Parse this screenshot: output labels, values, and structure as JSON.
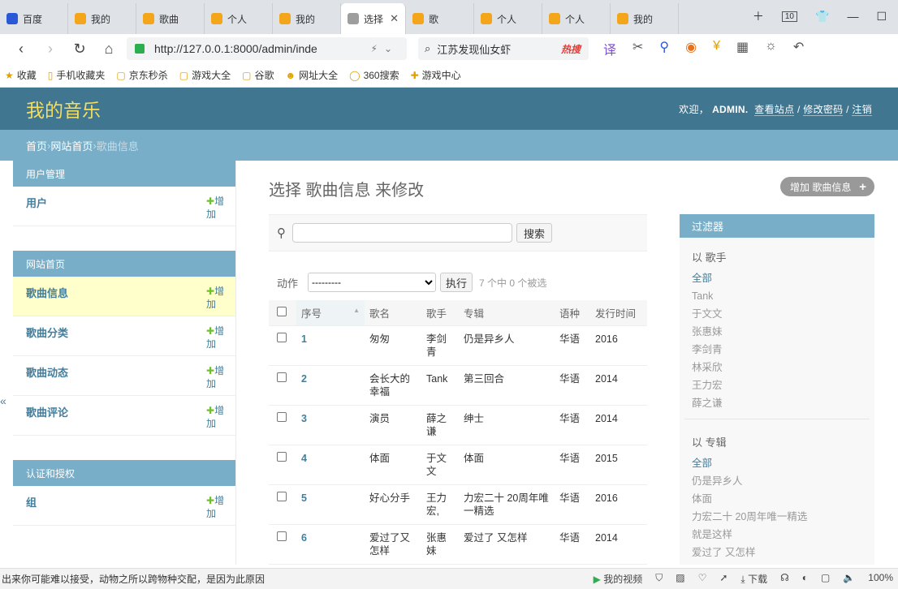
{
  "browser": {
    "tabs": [
      {
        "label": "百度",
        "color": "#2b58d6"
      },
      {
        "label": "我的",
        "color": "#f4a61a"
      },
      {
        "label": "歌曲",
        "color": "#f4a61a"
      },
      {
        "label": "个人",
        "color": "#f4a61a"
      },
      {
        "label": "我的",
        "color": "#f4a61a"
      },
      {
        "label": "选择",
        "color": "#9e9e9e"
      },
      {
        "label": "歌",
        "color": "#f4a61a"
      },
      {
        "label": "个人",
        "color": "#f4a61a"
      },
      {
        "label": "个人",
        "color": "#f4a61a"
      },
      {
        "label": "我的",
        "color": "#f4a61a"
      }
    ],
    "tab_count": "10",
    "url": "http://127.0.0.1:8000/admin/inde",
    "search_text": "江苏发现仙女虾",
    "search_hot": "热搜",
    "bookmarks": [
      "收藏",
      "手机收藏夹",
      "京东秒杀",
      "游戏大全",
      "谷歌",
      "网址大全",
      "360搜索",
      "游戏中心"
    ]
  },
  "header": {
    "brand": "我的音乐",
    "welcome": "欢迎，",
    "user": "ADMIN.",
    "view_site": "查看站点",
    "change_password": "修改密码",
    "logout": "注销",
    "sep": " / "
  },
  "breadcrumbs": {
    "home": "首页",
    "app": "网站首页",
    "current": "歌曲信息",
    "sep": " › "
  },
  "sidebar": {
    "add_label": "增加",
    "modules": [
      {
        "caption": "用户管理",
        "items": [
          {
            "name": "用户"
          }
        ]
      },
      {
        "caption": "网站首页",
        "items": [
          {
            "name": "歌曲信息"
          },
          {
            "name": "歌曲分类"
          },
          {
            "name": "歌曲动态"
          },
          {
            "name": "歌曲评论"
          }
        ]
      },
      {
        "caption": "认证和授权",
        "items": [
          {
            "name": "组"
          }
        ]
      }
    ],
    "collapse": "«"
  },
  "content": {
    "title": "选择 歌曲信息 来修改",
    "add_button": "增加 歌曲信息",
    "search_button": "搜索",
    "action_label": "动作",
    "action_default": "---------",
    "run_button": "执行",
    "selection_count": "7 个中 0 个被选",
    "columns": [
      "序号",
      "歌名",
      "歌手",
      "专辑",
      "语种",
      "发行时间"
    ],
    "rows": [
      [
        "1",
        "匆匆",
        "李剑青",
        "仍是异乡人",
        "华语",
        "2016"
      ],
      [
        "2",
        "会长大的幸福",
        "Tank",
        "第三回合",
        "华语",
        "2014"
      ],
      [
        "3",
        "演员",
        "薛之谦",
        "绅士",
        "华语",
        "2014"
      ],
      [
        "4",
        "体面",
        "于文文",
        "体面",
        "华语",
        "2015"
      ],
      [
        "5",
        "好心分手",
        "王力宏,",
        "力宏二十 20周年唯一精选",
        "华语",
        "2016"
      ],
      [
        "6",
        "爱过了又怎样",
        "张惠妹",
        "爱过了 又怎样",
        "华语",
        "2014"
      ]
    ]
  },
  "filter": {
    "caption": "过滤器",
    "singer_title": "以 歌手",
    "singers": [
      "全部",
      "Tank",
      "于文文",
      "张惠妹",
      "李剑青",
      "林采欣",
      "王力宏",
      "薛之谦"
    ],
    "album_title": "以 专辑",
    "albums": [
      "全部",
      "仍是异乡人",
      "体面",
      "力宏二十 20周年唯一精选",
      "就是这样",
      "爱过了 又怎样"
    ]
  },
  "status": {
    "left": "出来你可能难以接受，动物之所以跨物种交配，是因为此原因",
    "video": "我的视频",
    "download": "下载",
    "zoom": "100%"
  }
}
